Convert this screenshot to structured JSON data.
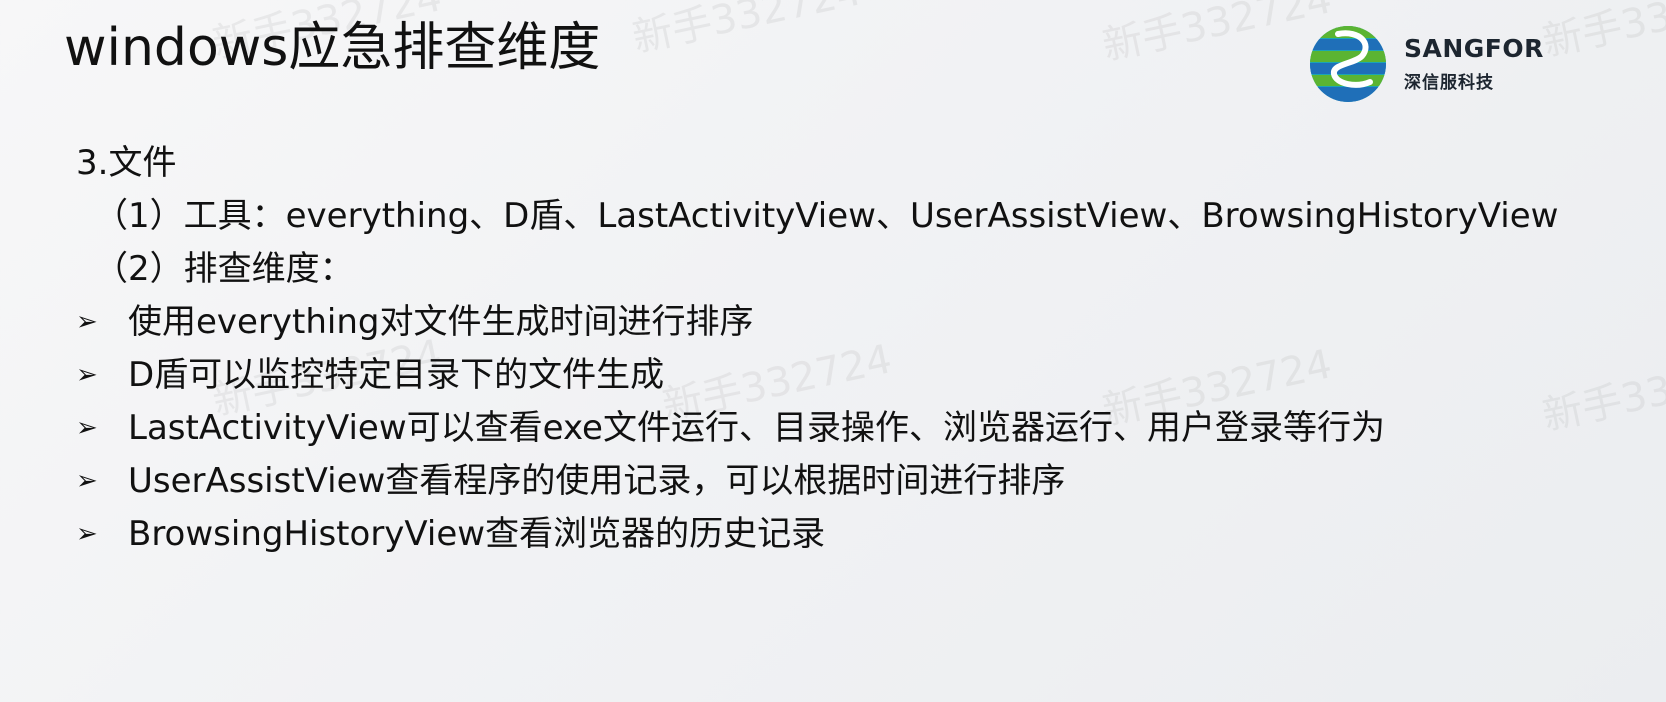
{
  "slide": {
    "title": "windows应急排查维度",
    "watermark_text": "新手332724"
  },
  "logo": {
    "name": "SANGFOR",
    "subtitle": "深信服科技",
    "colors": {
      "blue": "#1f6fb8",
      "green": "#5bb432",
      "teal": "#1aa5b5"
    }
  },
  "content": {
    "section_heading": "3.文件",
    "item_tools": "（1）工具：everything、D盾、LastActivityView、UserAssistView、BrowsingHistoryView",
    "item_dimensions": "（2）排查维度：",
    "bullet_icon": "arrow-bullet-icon",
    "bullets": [
      "使用everything对文件生成时间进行排序",
      "D盾可以监控特定目录下的文件生成",
      "LastActivityView可以查看exe文件运行、目录操作、浏览器运行、用户登录等行为",
      "UserAssistView查看程序的使用记录，可以根据时间进行排序",
      "BrowsingHistoryView查看浏览器的历史记录"
    ]
  }
}
